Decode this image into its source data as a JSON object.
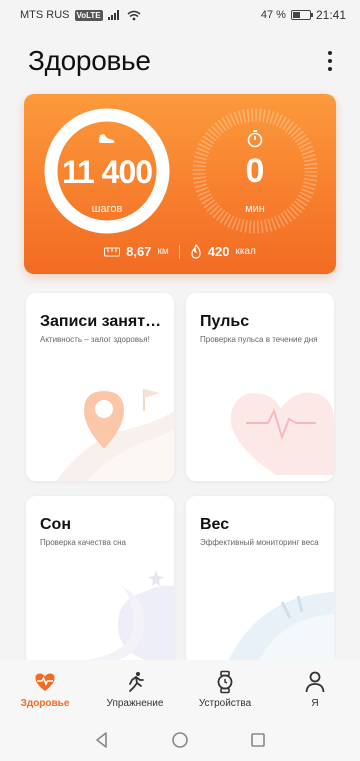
{
  "status_bar": {
    "carrier": "MTS RUS",
    "volte": "VoLTE",
    "battery": "47 %",
    "battery_level": 0.47,
    "time": "21:41"
  },
  "header": {
    "title": "Здоровье"
  },
  "summary": {
    "steps_value": "11 400",
    "steps_unit": "шагов",
    "minutes_value": "0",
    "minutes_unit": "мин",
    "distance_value": "8,67",
    "distance_unit": "км",
    "calories_value": "420",
    "calories_unit": "ккал"
  },
  "cards": [
    {
      "title": "Записи занят…",
      "subtitle": "Активность – залог здоровья!"
    },
    {
      "title": "Пульс",
      "subtitle": "Проверка пульса в течение дня"
    },
    {
      "title": "Сон",
      "subtitle": "Проверка качества сна"
    },
    {
      "title": "Вес",
      "subtitle": "Эффективный мониторинг веса"
    }
  ],
  "nav": {
    "items": [
      {
        "label": "Здоровье",
        "icon": "heart-pulse-icon",
        "active": true
      },
      {
        "label": "Упражнение",
        "icon": "running-icon",
        "active": false
      },
      {
        "label": "Устройства",
        "icon": "watch-icon",
        "active": false
      },
      {
        "label": "Я",
        "icon": "person-icon",
        "active": false
      }
    ]
  },
  "colors": {
    "accent": "#f26b23",
    "hero_top": "#fb9a3c",
    "hero_bottom": "#f26b23"
  }
}
